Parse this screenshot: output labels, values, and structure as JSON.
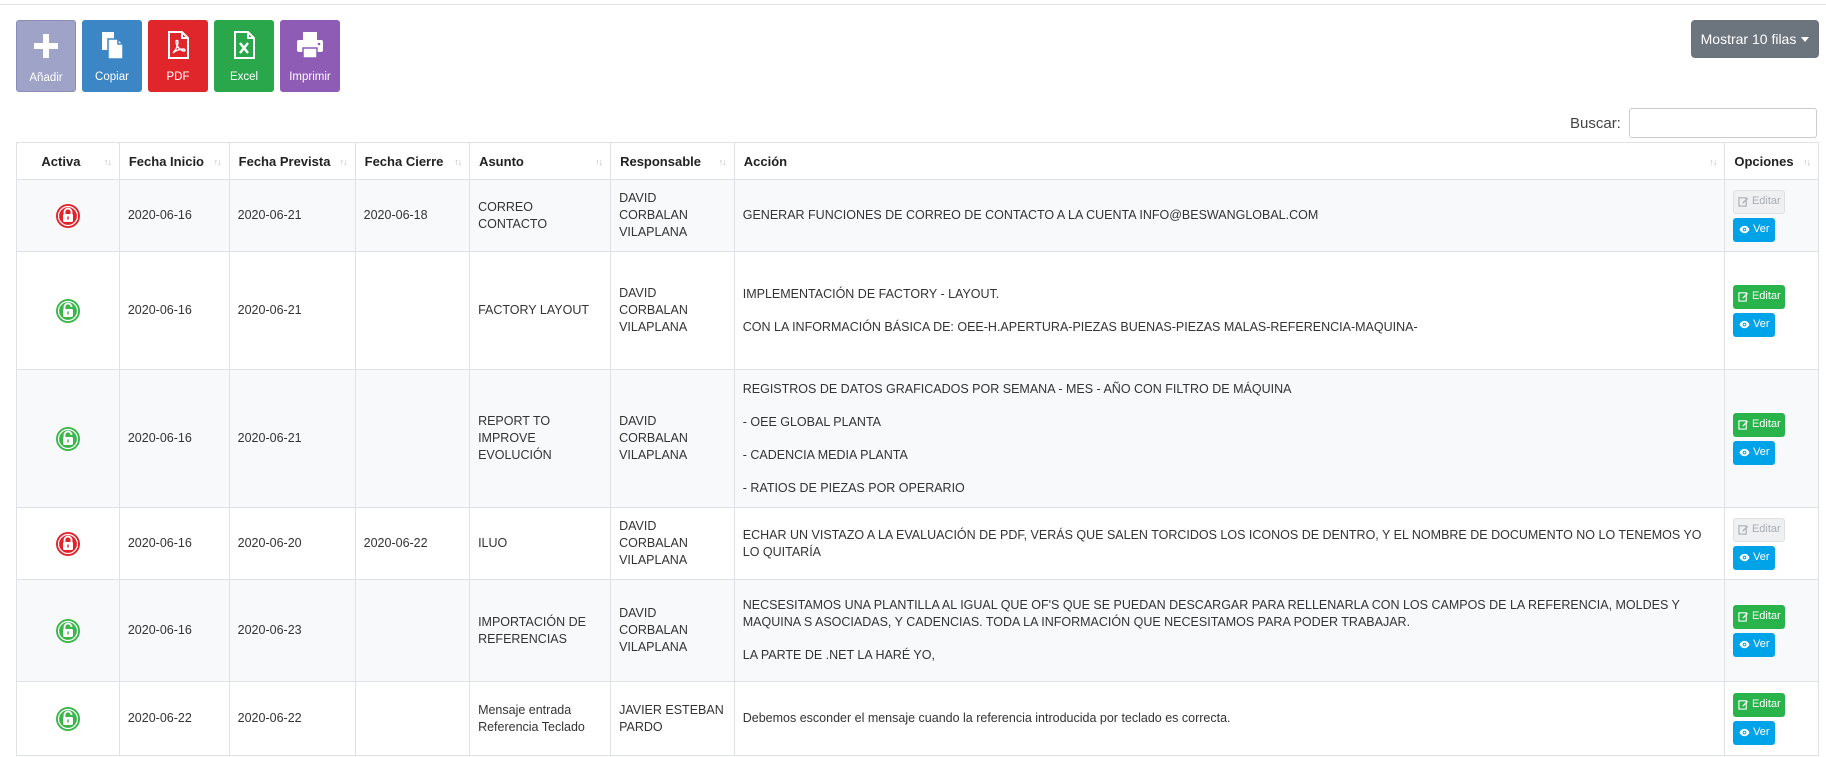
{
  "toolbar": {
    "buttons": [
      {
        "label": "Añadir",
        "icon": "plus-icon",
        "color": "#a0a3c8"
      },
      {
        "label": "Copiar",
        "icon": "copy-icon",
        "color": "#3c86c5"
      },
      {
        "label": "PDF",
        "icon": "file-pdf-icon",
        "color": "#e1262b"
      },
      {
        "label": "Excel",
        "icon": "file-excel-icon",
        "color": "#2aa74a"
      },
      {
        "label": "Imprimir",
        "icon": "printer-icon",
        "color": "#8e5bb5"
      }
    ]
  },
  "rows_menu": {
    "label": "Mostrar 10 filas"
  },
  "search": {
    "label": "Buscar:",
    "value": ""
  },
  "table": {
    "columns": [
      "Activa",
      "Fecha Inicio",
      "Fecha Prevista",
      "Fecha Cierre",
      "Asunto",
      "Responsable",
      "Acción",
      "Opciones"
    ],
    "edit_label": "Editar",
    "view_label": "Ver",
    "rows": [
      {
        "active": false,
        "fecha_inicio": "2020-06-16",
        "fecha_prevista": "2020-06-21",
        "fecha_cierre": "2020-06-18",
        "asunto": "CORREO CONTACTO",
        "responsable": "DAVID CORBALAN VILAPLANA",
        "accion": [
          "GENERAR FUNCIONES DE CORREO DE CONTACTO A LA CUENTA INFO@BESWANGLOBAL.COM"
        ]
      },
      {
        "active": true,
        "fecha_inicio": "2020-06-16",
        "fecha_prevista": "2020-06-21",
        "fecha_cierre": "",
        "asunto": "FACTORY LAYOUT",
        "responsable": "DAVID CORBALAN VILAPLANA",
        "accion": [
          "IMPLEMENTACIÓN DE FACTORY - LAYOUT.",
          "CON LA INFORMACIÓN BÁSICA DE: OEE-H.APERTURA-PIEZAS BUENAS-PIEZAS MALAS-REFERENCIA-MAQUINA-"
        ]
      },
      {
        "active": true,
        "fecha_inicio": "2020-06-16",
        "fecha_prevista": "2020-06-21",
        "fecha_cierre": "",
        "asunto": "REPORT TO IMPROVE EVOLUCIÓN",
        "responsable": "DAVID CORBALAN VILAPLANA",
        "accion": [
          "REGISTROS DE DATOS GRAFICADOS POR SEMANA - MES - AÑO CON FILTRO DE MÁQUINA",
          "- OEE GLOBAL PLANTA",
          "- CADENCIA MEDIA PLANTA",
          "- RATIOS DE PIEZAS POR OPERARIO"
        ]
      },
      {
        "active": false,
        "fecha_inicio": "2020-06-16",
        "fecha_prevista": "2020-06-20",
        "fecha_cierre": "2020-06-22",
        "asunto": "ILUO",
        "responsable": "DAVID CORBALAN VILAPLANA",
        "accion": [
          "ECHAR UN VISTAZO A LA EVALUACIÓN DE PDF, VERÁS QUE SALEN TORCIDOS LOS ICONOS DE DENTRO, Y EL NOMBRE DE DOCUMENTO NO LO TENEMOS YO LO QUITARÍA"
        ]
      },
      {
        "active": true,
        "fecha_inicio": "2020-06-16",
        "fecha_prevista": "2020-06-23",
        "fecha_cierre": "",
        "asunto": "IMPORTACIÓN DE REFERENCIAS",
        "responsable": "DAVID CORBALAN VILAPLANA",
        "accion": [
          "NECSESITAMOS UNA PLANTILLA AL IGUAL QUE OF'S QUE SE PUEDAN DESCARGAR PARA RELLENARLA CON LOS CAMPOS DE LA REFERENCIA, MOLDES Y MAQUINA S ASOCIADAS, Y CADENCIAS. TODA LA INFORMACIÓN QUE NECESITAMOS PARA PODER TRABAJAR.",
          "LA PARTE DE .NET LA HARÉ YO,"
        ]
      },
      {
        "active": true,
        "fecha_inicio": "2020-06-22",
        "fecha_prevista": "2020-06-22",
        "fecha_cierre": "",
        "asunto": "Mensaje entrada Referencia Teclado",
        "responsable": "JAVIER ESTEBAN PARDO",
        "accion": [
          "Debemos esconder el mensaje cuando la referencia introducida por teclado es correcta."
        ]
      }
    ]
  },
  "colors": {
    "active_lock": "#3cb54a",
    "inactive_lock": "#e0242b",
    "edit_button": "#28b44b",
    "view_button": "#00a3e8"
  }
}
